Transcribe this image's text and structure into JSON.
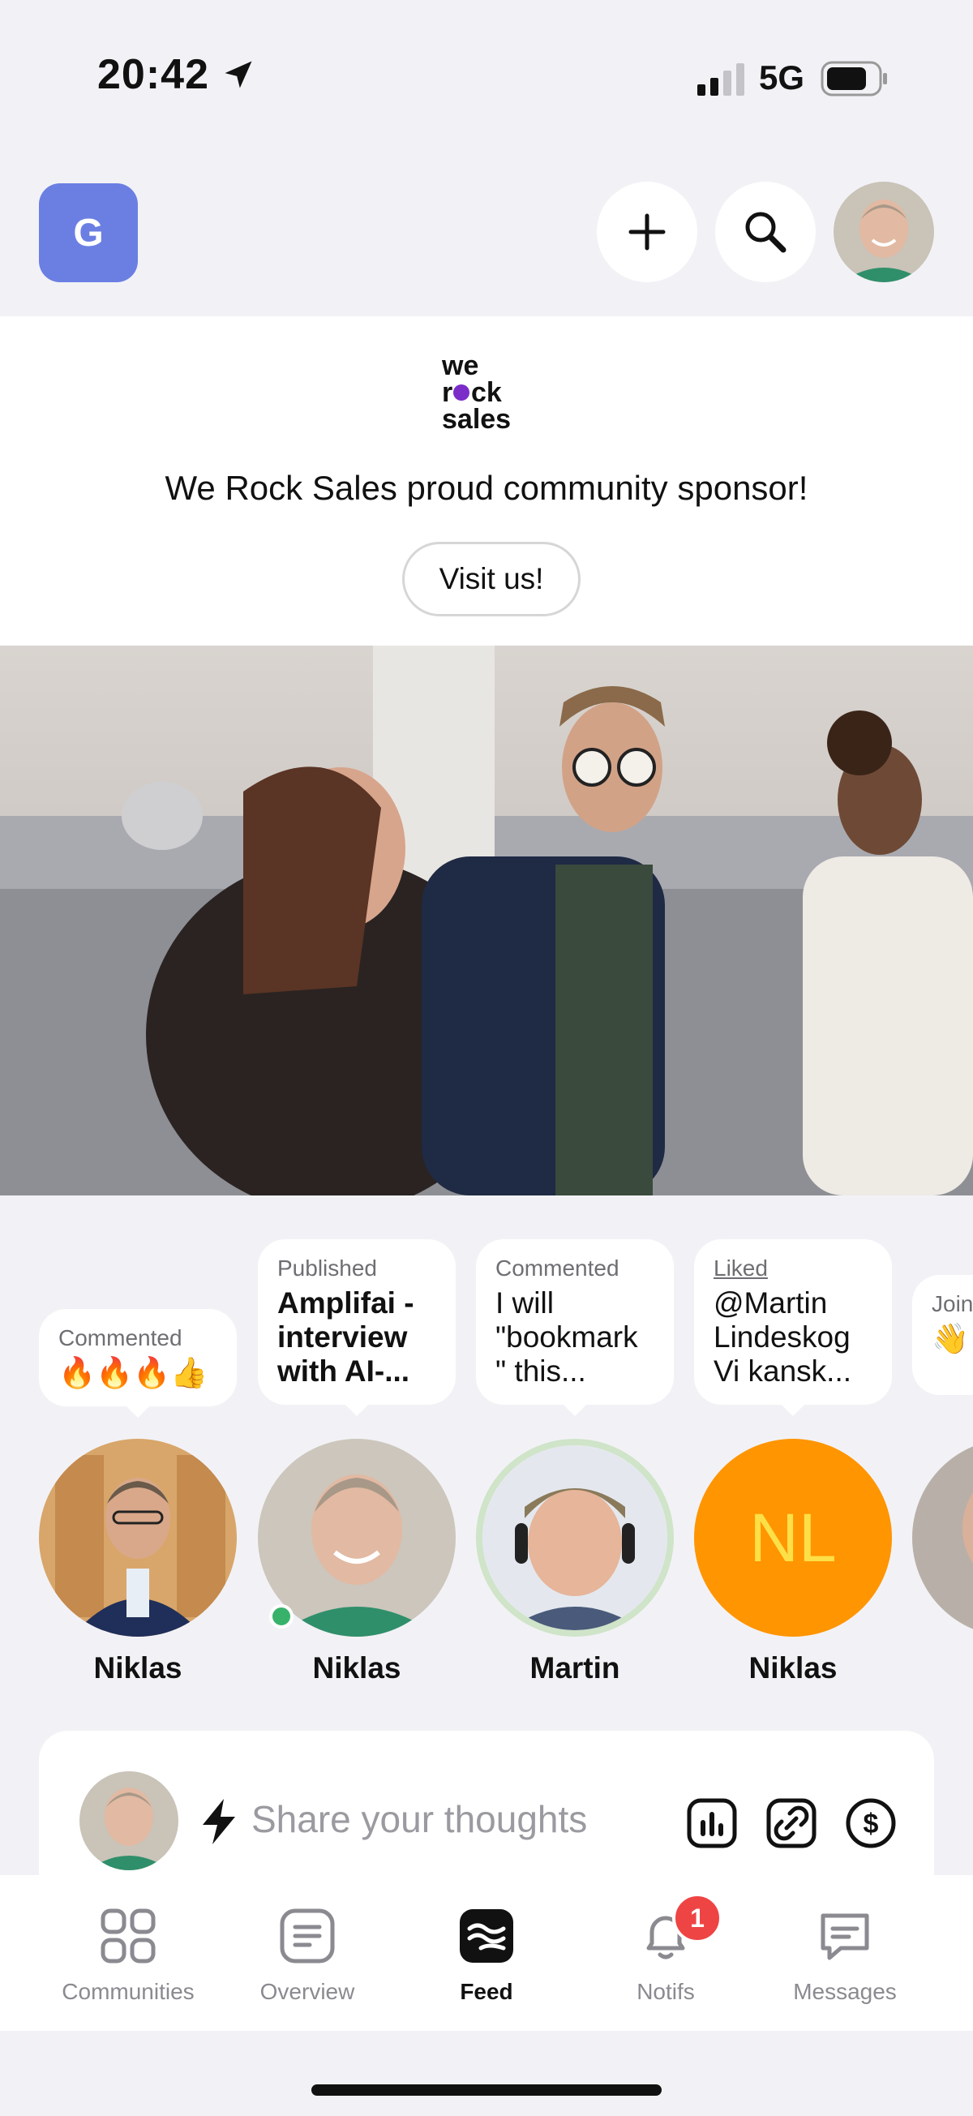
{
  "status_bar": {
    "time": "20:42",
    "network": "5G"
  },
  "header": {
    "community_initial": "G",
    "add_icon": "plus-icon",
    "search_icon": "search-icon"
  },
  "sponsor": {
    "logo_lines": [
      "we",
      "rock",
      "sales"
    ],
    "text": "We Rock Sales proud community sponsor!",
    "button_label": "Visit us!"
  },
  "activity": [
    {
      "action": "Commented",
      "text": "🔥🔥🔥👍",
      "name": "Niklas"
    },
    {
      "action": "Published",
      "text": "Amplifai - interview with AI-...",
      "name": "Niklas"
    },
    {
      "action": "Commented",
      "text": "I will \"bookmark \" this...",
      "name": "Martin"
    },
    {
      "action": "Liked",
      "text": "@Martin Lindeskog Vi kansk...",
      "name": "Niklas",
      "initials": "NL"
    },
    {
      "action": "Join",
      "text": "👋",
      "name": ""
    }
  ],
  "composer": {
    "placeholder": "Share your thoughts"
  },
  "tabs": [
    {
      "label": "Communities",
      "icon": "grid-icon"
    },
    {
      "label": "Overview",
      "icon": "document-icon"
    },
    {
      "label": "Feed",
      "icon": "feed-icon"
    },
    {
      "label": "Notifs",
      "icon": "bell-icon",
      "badge": "1"
    },
    {
      "label": "Messages",
      "icon": "chat-icon"
    }
  ],
  "colors": {
    "community_avatar": "#6b7fe3",
    "initials_avatar": "#ff9500",
    "badge": "#ef4444",
    "online": "#38b26b"
  }
}
